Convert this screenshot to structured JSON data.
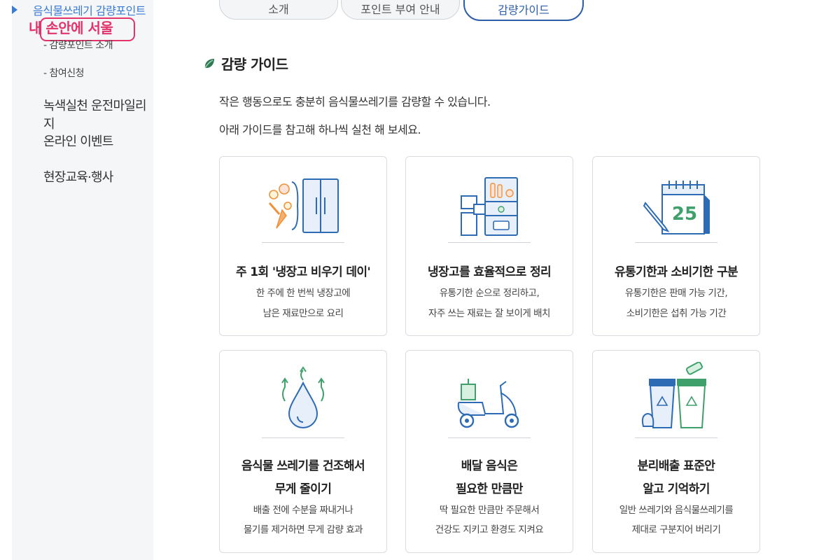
{
  "sidebar": {
    "active_item": "음식물쓰레기 감량포인트",
    "stamp": "내 손안에 서울",
    "sub_items": [
      "- 감량포인트 소개",
      "- 참여신청"
    ],
    "items": [
      "녹색실천 운전마일리지",
      "온라인 이벤트",
      "현장교육·행사"
    ]
  },
  "tabs": [
    {
      "label": "소개"
    },
    {
      "label": "포인트 부여 안내"
    },
    {
      "label": "감량가이드"
    }
  ],
  "section": {
    "title": "감량 가이드",
    "intro": [
      "작은 행동으로도 충분히 음식물쓰레기를 감량할 수 있습니다.",
      "아래 가이드를 참고해 하나씩 실천 해 보세요."
    ]
  },
  "cards": [
    {
      "icon": "fridge-food-icon",
      "title": "주 1회 '냉장고 비우기 데이'",
      "desc": [
        "한 주에 한 번씩 냉장고에",
        "남은 재료만으로 요리"
      ]
    },
    {
      "icon": "organized-fridge-icon",
      "title": "냉장고를 효율적으로 정리",
      "desc": [
        "유통기한 순으로 정리하고,",
        "자주 쓰는 재료는 잘 보이게 배치"
      ]
    },
    {
      "icon": "calendar-icon",
      "title": "유통기한과 소비기한 구분",
      "desc": [
        "유통기한은 판매 가능 기간,",
        "소비기한은 섭취 가능 기간"
      ],
      "calendar_number": "25"
    },
    {
      "icon": "water-drop-icon",
      "title": [
        "음식물 쓰레기를 건조해서",
        "무게 줄이기"
      ],
      "desc": [
        "배출 전에 수분을 짜내거나",
        "물기를 제거하면 무게 감량 효과"
      ]
    },
    {
      "icon": "delivery-scooter-icon",
      "title": [
        "배달 음식은",
        "필요한 만큼만"
      ],
      "desc": [
        "딱 필요한 만큼만 주문해서",
        "건강도 지키고 환경도 지켜요"
      ]
    },
    {
      "icon": "recycling-bins-icon",
      "title": [
        "분리배출 표준안",
        "알고 기억하기"
      ],
      "desc": [
        "일반 쓰레기와 음식물쓰레기를",
        "제대로 구분지어 버리기"
      ]
    }
  ],
  "colors": {
    "accent": "#2d5fa8",
    "icon_blue": "#2e6bb5",
    "icon_green": "#3fa06b",
    "icon_orange": "#f0913a",
    "stamp": "#e2336b"
  }
}
